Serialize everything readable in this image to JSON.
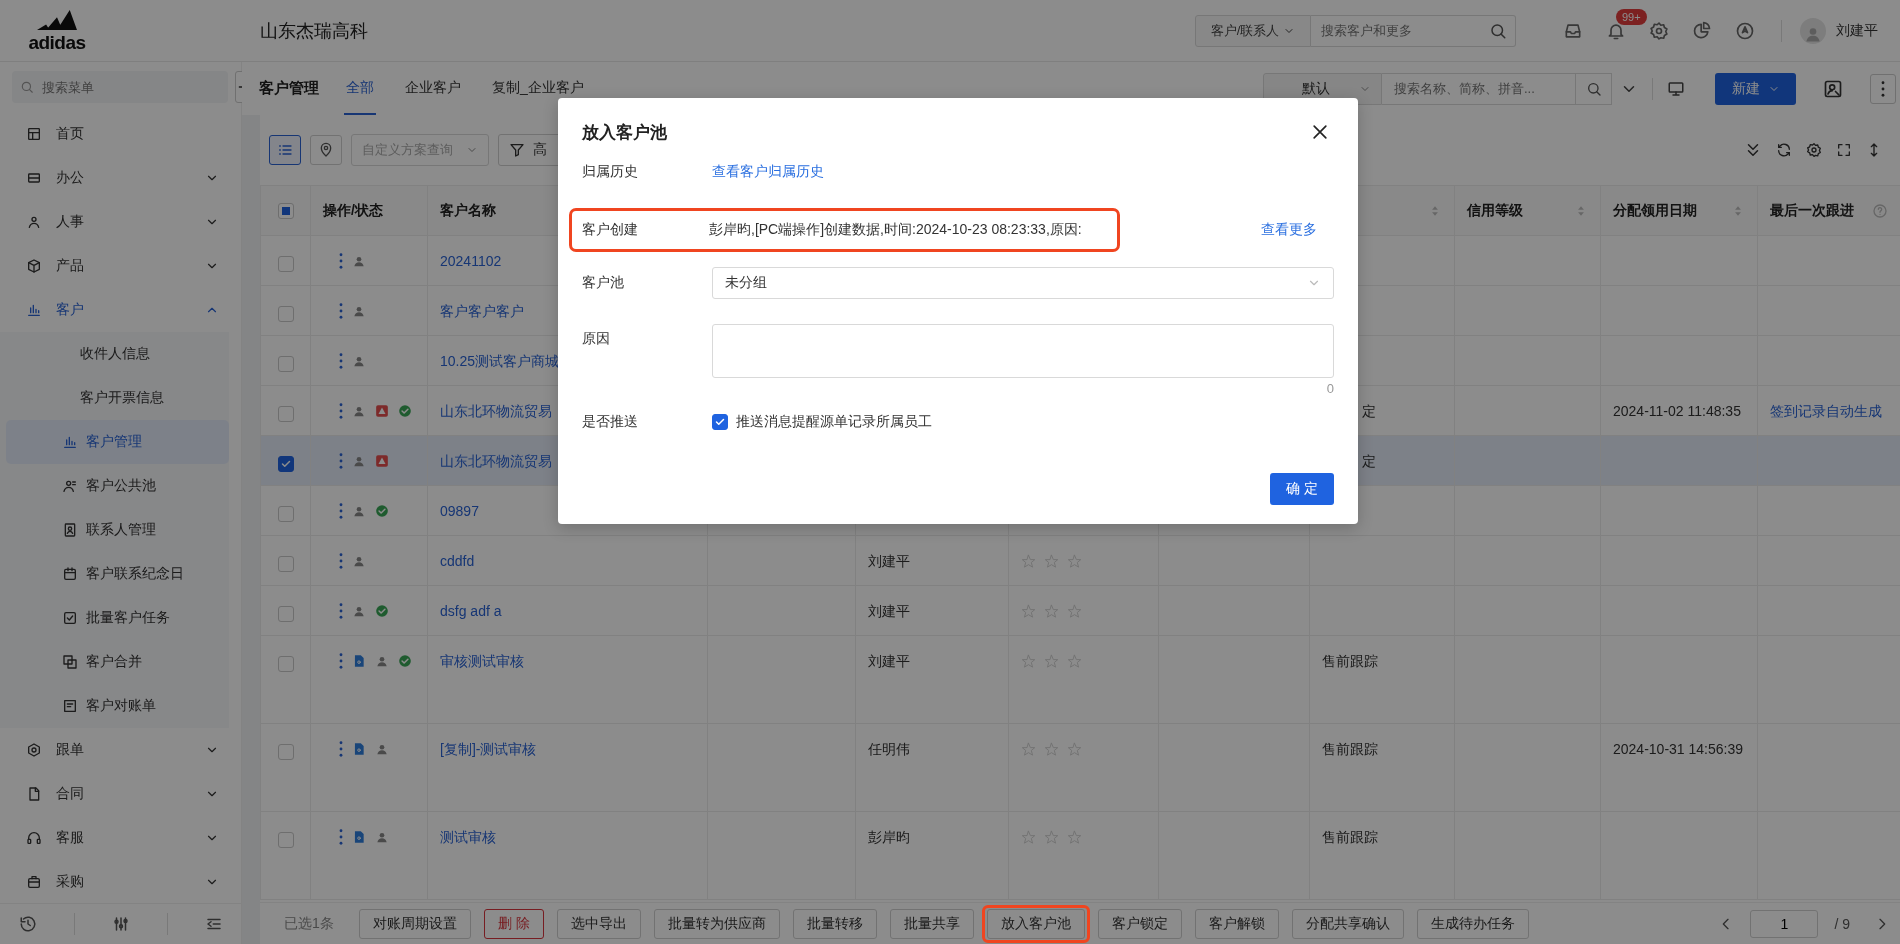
{
  "header": {
    "logo": "adidas",
    "company": "山东杰瑞高科",
    "search_scope": "客户/联系人",
    "search": {
      "placeholder": "搜索客户和更多"
    },
    "notification_badge": "99+",
    "user": "刘建平"
  },
  "sidebar": {
    "search": {
      "placeholder": "搜索菜单"
    },
    "items": [
      {
        "label": "首页",
        "kind": "link"
      },
      {
        "label": "办公",
        "kind": "group",
        "expanded": false
      },
      {
        "label": "人事",
        "kind": "group",
        "expanded": false
      },
      {
        "label": "产品",
        "kind": "group",
        "expanded": false
      },
      {
        "label": "客户",
        "kind": "group",
        "expanded": true,
        "children": [
          {
            "label": "收件人信息",
            "selected": false
          },
          {
            "label": "客户开票信息",
            "selected": false
          },
          {
            "label": "客户管理",
            "selected": true
          },
          {
            "label": "客户公共池",
            "selected": false
          },
          {
            "label": "联系人管理",
            "selected": false
          },
          {
            "label": "客户联系纪念日",
            "selected": false
          },
          {
            "label": "批量客户任务",
            "selected": false
          },
          {
            "label": "客户合并",
            "selected": false
          },
          {
            "label": "客户对账单",
            "selected": false
          }
        ]
      },
      {
        "label": "跟单",
        "kind": "group",
        "expanded": false
      },
      {
        "label": "合同",
        "kind": "group",
        "expanded": false
      },
      {
        "label": "客服",
        "kind": "group",
        "expanded": false
      },
      {
        "label": "采购",
        "kind": "group",
        "expanded": false
      }
    ]
  },
  "page": {
    "title": "客户管理",
    "tabs": [
      {
        "label": "全部",
        "selected": true
      },
      {
        "label": "企业客户",
        "selected": false
      },
      {
        "label": "复制_企业客户",
        "selected": false
      }
    ],
    "view_select": "默认",
    "search": {
      "placeholder": "搜索名称、简称、拼音..."
    },
    "new_button": "新建"
  },
  "toolbar": {
    "view_modes": [
      {
        "selected": true
      },
      {
        "selected": false
      }
    ],
    "scheme_select": {
      "placeholder": "自定义方案查询"
    },
    "filter_button": "高"
  },
  "table": {
    "header_checkbox": {
      "indeterminate": true
    },
    "columns": [
      {
        "label": "操作/状态"
      },
      {
        "label": "客户名称"
      },
      {
        "sortable": true
      },
      {
        "label": "信用等级",
        "sortable": true
      },
      {
        "label": "分配领用日期",
        "sortable": true
      },
      {
        "label": "最后一次跟进",
        "help": true
      }
    ],
    "rows": [
      {
        "selected": false,
        "badges": [
          {
            "kind": "person"
          }
        ],
        "name": "20241102"
      },
      {
        "selected": false,
        "badges": [
          {
            "kind": "person"
          }
        ],
        "name": "客户客户客户"
      },
      {
        "selected": false,
        "badges": [
          {
            "kind": "person"
          }
        ],
        "name": "10.25测试客户商城"
      },
      {
        "selected": false,
        "badges": [
          {
            "kind": "person"
          },
          {
            "kind": "warning"
          },
          {
            "kind": "check"
          }
        ],
        "name": "山东北环物流贸易",
        "status": "定",
        "status_covered": true,
        "assigned_date": "2024-11-02 11:48:35",
        "last_follow_up": "签到记录自动生成"
      },
      {
        "selected": true,
        "badges": [
          {
            "kind": "person"
          },
          {
            "kind": "warning"
          }
        ],
        "name": "山东北环物流贸易",
        "status": "定",
        "status_covered": true
      },
      {
        "selected": false,
        "badges": [
          {
            "kind": "person"
          },
          {
            "kind": "check"
          }
        ],
        "name": "09897"
      },
      {
        "selected": false,
        "badges": [
          {
            "kind": "person"
          }
        ],
        "name": "cddfd",
        "owner": "刘建平",
        "stars": 0
      },
      {
        "selected": false,
        "badges": [
          {
            "kind": "person"
          },
          {
            "kind": "check"
          }
        ],
        "name": "dsfg adf a",
        "owner": "刘建平",
        "stars": 0
      },
      {
        "selected": false,
        "badges": [
          {
            "kind": "doc"
          },
          {
            "kind": "person"
          },
          {
            "kind": "check"
          }
        ],
        "name": "审核测试审核",
        "owner": "刘建平",
        "stars": 0,
        "status": "售前跟踪"
      },
      {
        "selected": false,
        "badges": [
          {
            "kind": "doc"
          },
          {
            "kind": "person"
          }
        ],
        "name": "[复制]-测试审核",
        "owner": "任明伟",
        "stars": 0,
        "status": "售前跟踪",
        "assigned_date": "2024-10-31 14:56:39"
      },
      {
        "selected": false,
        "badges": [
          {
            "kind": "doc"
          },
          {
            "kind": "person"
          }
        ],
        "name": "测试审核",
        "owner": "彭岸昀",
        "stars": 0,
        "status": "售前跟踪"
      }
    ]
  },
  "bottom_bar": {
    "selection_count": "已选1条",
    "actions": [
      {
        "label": "对账周期设置",
        "kind": "default",
        "annotated": false
      },
      {
        "label": "删 除",
        "kind": "danger",
        "annotated": false
      },
      {
        "label": "选中导出",
        "kind": "default",
        "annotated": false
      },
      {
        "label": "批量转为供应商",
        "kind": "default",
        "annotated": false
      },
      {
        "label": "批量转移",
        "kind": "default",
        "annotated": false
      },
      {
        "label": "批量共享",
        "kind": "default",
        "annotated": false
      },
      {
        "label": "放入客户池",
        "kind": "default",
        "annotated": true
      },
      {
        "label": "客户锁定",
        "kind": "default",
        "annotated": false
      },
      {
        "label": "客户解锁",
        "kind": "default",
        "annotated": false
      },
      {
        "label": "分配共享确认",
        "kind": "default",
        "annotated": false
      },
      {
        "label": "生成待办任务",
        "kind": "default",
        "annotated": false
      }
    ],
    "pagination": {
      "page": "1",
      "page_total": "/ 9"
    }
  },
  "dialog": {
    "title": "放入客户池",
    "fields": [
      {
        "kind": "link",
        "label": "归属历史",
        "value": "查看客户归属历史",
        "annotated": false
      },
      {
        "kind": "text",
        "label": "客户创建",
        "value": "彭岸昀,[PC端操作]创建数据,时间:2024-10-23 08:23:33,原因:",
        "action": "查看更多",
        "annotated": true
      },
      {
        "kind": "select",
        "label": "客户池",
        "value": "未分组",
        "annotated": false
      },
      {
        "kind": "textarea",
        "label": "原因",
        "counter": "0",
        "annotated": false
      },
      {
        "kind": "checkbox",
        "label": "是否推送",
        "checked": true,
        "text": "推送消息提醒源单记录所属员工",
        "annotated": false
      }
    ],
    "confirm": "确 定"
  }
}
